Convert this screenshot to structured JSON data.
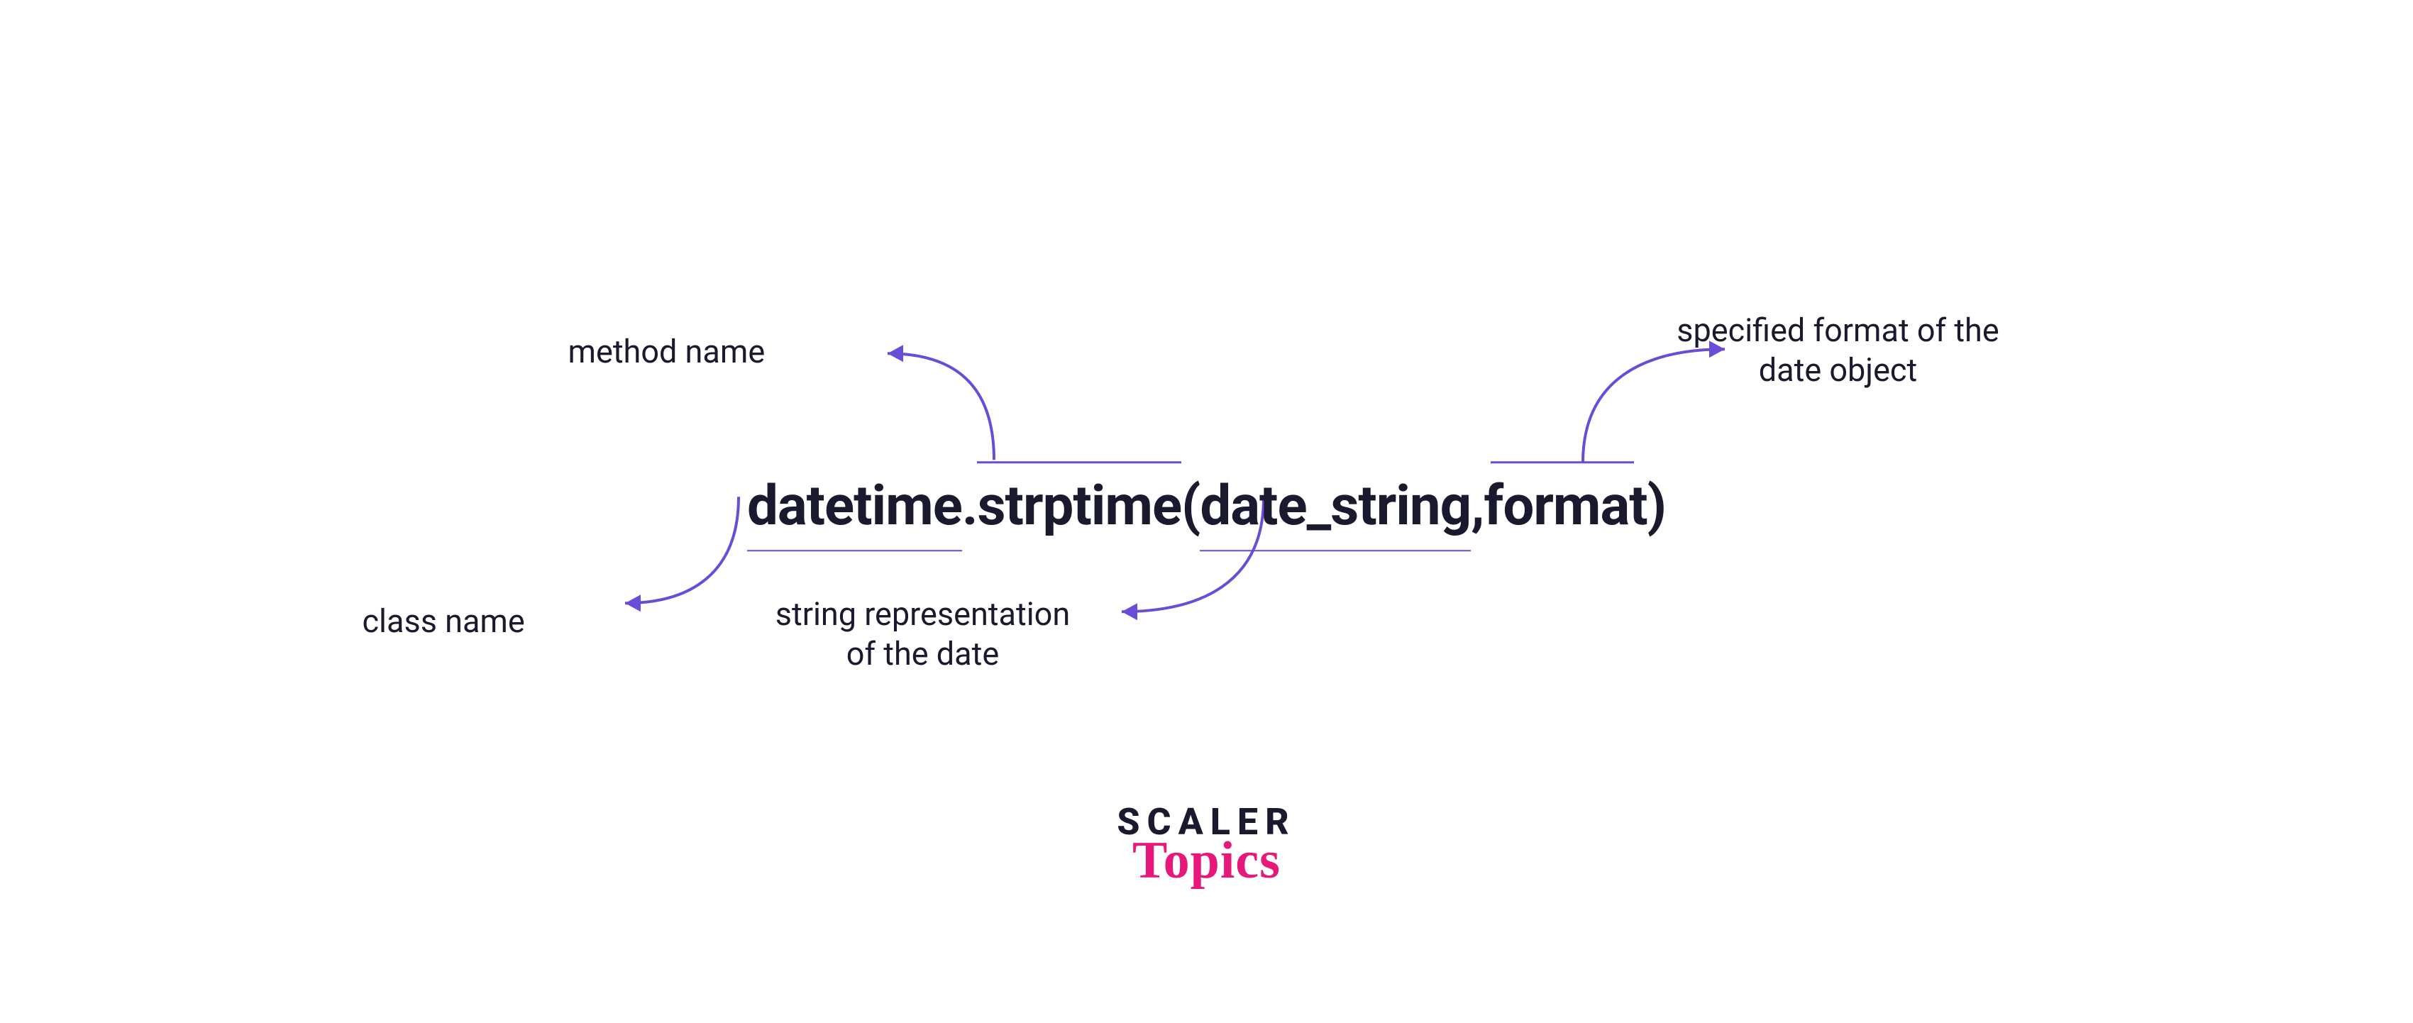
{
  "labels": {
    "method_name": "method name",
    "class_name": "class name",
    "date_string": "string representation of the date",
    "format_desc": "specified format of the date object"
  },
  "code": {
    "class": "datetime",
    "dot": ".",
    "method": "strptime",
    "open": "(",
    "arg1": "date_string",
    "comma": ",",
    "space": " ",
    "arg2": "format",
    "close": ")"
  },
  "logo": {
    "line1": "SCALER",
    "line2": "Topics"
  },
  "colors": {
    "ink": "#1a1a2e",
    "accent": "#6a4dd6",
    "brand_pink": "#e6187a"
  }
}
